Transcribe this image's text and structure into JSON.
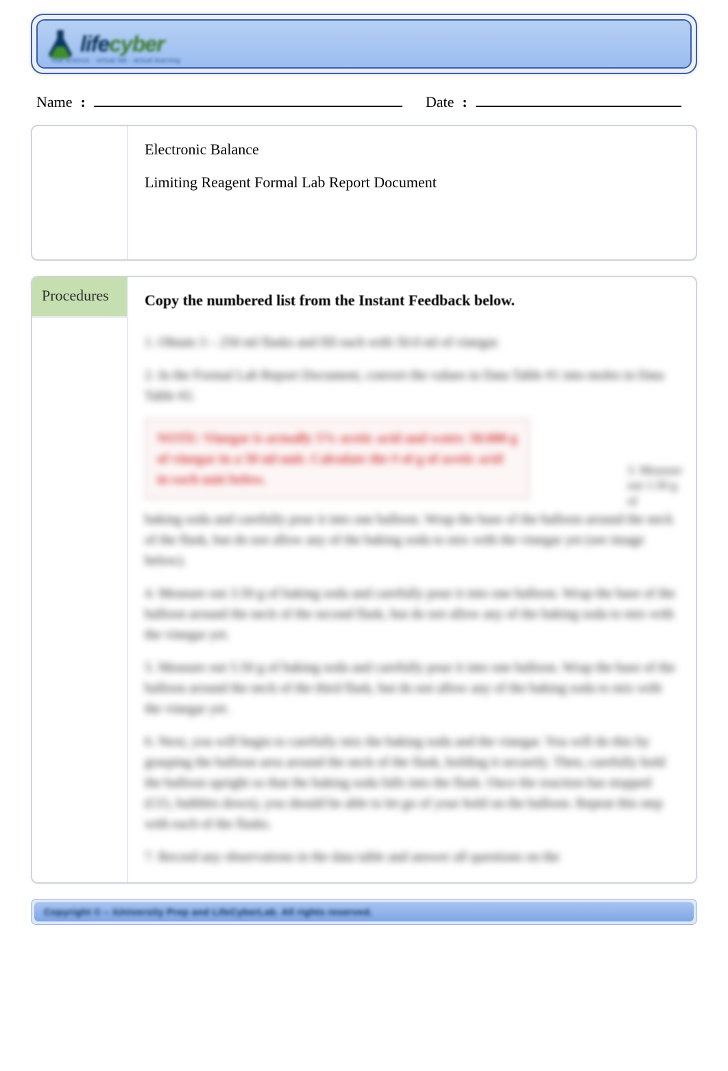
{
  "banner": {
    "logo_prefix": "life",
    "logo_suffix": "cyber",
    "tagline": "real science · virtual lab · actual learning"
  },
  "name_date": {
    "name_label": "Name",
    "date_label": "Date"
  },
  "materials": {
    "line1": "Electronic Balance",
    "line2": "Limiting Reagent Formal Lab Report Document"
  },
  "procedures": {
    "side_label": "Procedures",
    "heading": "Copy the numbered list from the Instant Feedback below.",
    "step1": "1.  Obtain 3 – 250 ml flasks and fill each with 50.0 ml of vinegar.",
    "step2": "2.  In the Formal Lab Report Document, convert the values in Data Table #1 into moles in Data Table #2.",
    "note": "NOTE: Vinegar is actually 5% acetic acid and water. 50.000 g of vinegar in a 50 ml unit. Calculate the # of g of acetic acid in each unit below.",
    "aside": "3. Measure out 1.50 g of",
    "step3a": "baking soda and carefully pour it into one balloon. Wrap the base of the balloon around the neck of the flask, but do not allow any of the baking soda to mix with the vinegar yet (see image below).",
    "step4": "4.  Measure out 3.50 g of baking soda and carefully pour it into one balloon. Wrap the base of the balloon around the neck of the second flask, but do not allow any of the baking soda to mix with the vinegar yet.",
    "step5": "5.  Measure out 5.50 g of baking soda and carefully pour it into one balloon. Wrap the base of the balloon around the neck of the third flask, but do not allow any of the baking soda to mix with the vinegar yet.",
    "step6": "6.  Next, you will begin to carefully mix the baking soda and the vinegar. You will do this by grasping the balloon area around the neck of the flask, holding it securely. Then, carefully hold the balloon upright so that the baking soda falls into the flask. Once the reaction has stopped (CO₂ bubbles down), you should be able to let go of your hold on the balloon. Repeat this step with each of the flasks.",
    "step7": "7.  Record any observations in the data table and answer all questions on the"
  },
  "footer": {
    "text": "Copyright © – iUniversity Prep and LifeCyberLab. All rights reserved."
  }
}
